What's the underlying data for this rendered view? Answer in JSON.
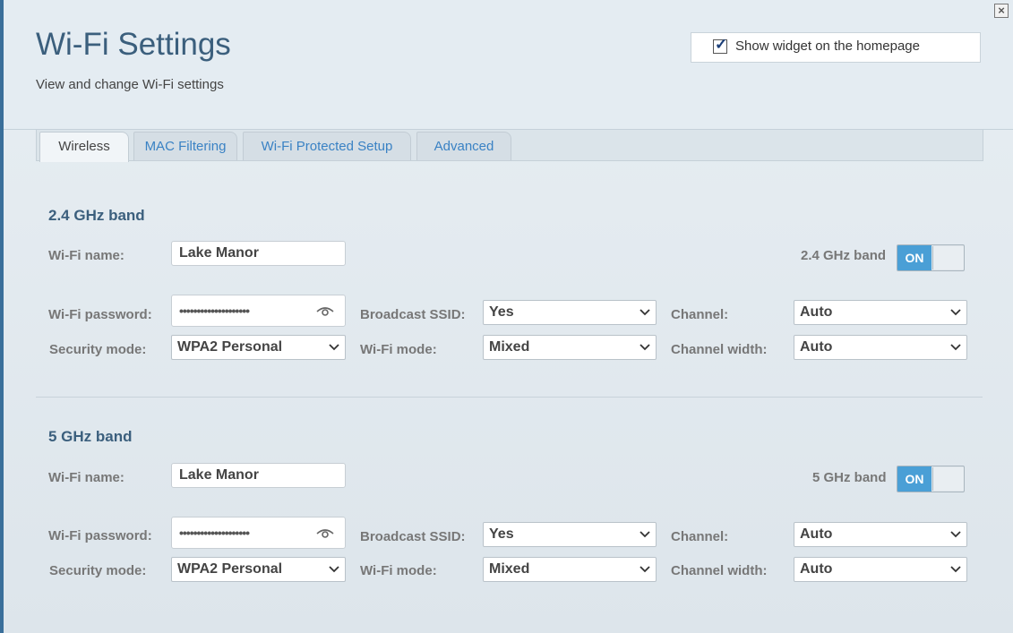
{
  "header": {
    "title": "Wi-Fi Settings",
    "subtitle": "View and change Wi-Fi settings",
    "widget_label": "Show widget on the homepage",
    "widget_checked": true
  },
  "tabs": [
    {
      "label": "Wireless",
      "active": true
    },
    {
      "label": "MAC Filtering",
      "active": false
    },
    {
      "label": "Wi-Fi Protected Setup",
      "active": false
    },
    {
      "label": "Advanced",
      "active": false
    }
  ],
  "labels": {
    "wifi_name": "Wi-Fi name:",
    "wifi_password": "Wi-Fi password:",
    "security_mode": "Security mode:",
    "broadcast_ssid": "Broadcast SSID:",
    "wifi_mode": "Wi-Fi mode:",
    "channel": "Channel:",
    "channel_width": "Channel width:"
  },
  "bands": [
    {
      "title": "2.4 GHz band",
      "toggle_label": "2.4 GHz band",
      "toggle_state": "ON",
      "wifi_name": "Lake Manor",
      "wifi_password": "••••••••••••••••••••",
      "security_mode": "WPA2 Personal",
      "broadcast_ssid": "Yes",
      "wifi_mode": "Mixed",
      "channel": "Auto",
      "channel_width": "Auto"
    },
    {
      "title": "5 GHz band",
      "toggle_label": "5 GHz band",
      "toggle_state": "ON",
      "wifi_name": "Lake Manor",
      "wifi_password": "••••••••••••••••••••",
      "security_mode": "WPA2 Personal",
      "broadcast_ssid": "Yes",
      "wifi_mode": "Mixed",
      "channel": "Auto",
      "channel_width": "Auto"
    }
  ],
  "colors": {
    "accent": "#4a9fd6",
    "title": "#3b5f7d",
    "tab_link": "#3a82c4"
  }
}
